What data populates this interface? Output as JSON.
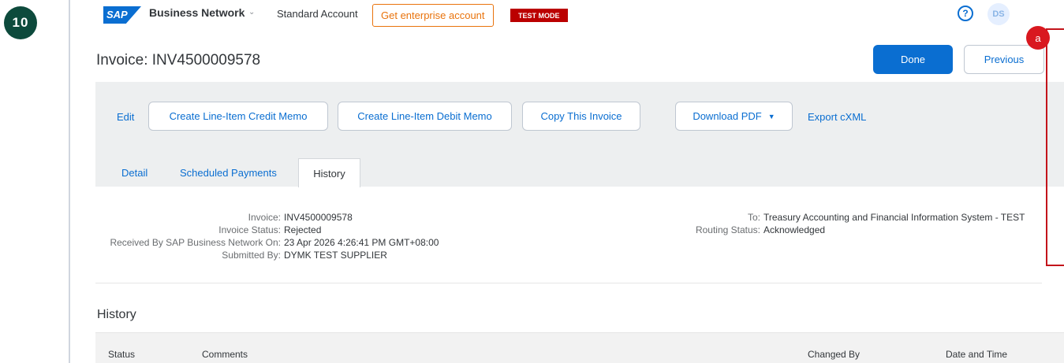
{
  "step": "10",
  "topbar": {
    "brand": "SAP",
    "product": "Business Network",
    "caret": "⌄",
    "account": "Standard Account",
    "enterprise_button": "Get enterprise account",
    "mode_badge": "TEST MODE",
    "help": "?",
    "avatar": "DS"
  },
  "header": {
    "title": "Invoice: INV4500009578",
    "done": "Done",
    "previous": "Previous"
  },
  "actions": {
    "edit": "Edit",
    "credit_memo": "Create Line-Item Credit Memo",
    "debit_memo": "Create Line-Item Debit Memo",
    "copy": "Copy This Invoice",
    "download": "Download PDF",
    "download_caret": "▼",
    "export": "Export cXML"
  },
  "tabs": {
    "detail": "Detail",
    "scheduled": "Scheduled Payments",
    "history": "History"
  },
  "summary": {
    "left": [
      {
        "label": "Invoice:",
        "value": "INV4500009578"
      },
      {
        "label": "Invoice Status:",
        "value": "Rejected"
      },
      {
        "label": "Received By SAP Business Network On:",
        "value": "23 Apr 2026 4:26:41 PM GMT+08:00"
      },
      {
        "label": "Submitted By:",
        "value": "DYMK TEST SUPPLIER"
      }
    ],
    "right": [
      {
        "label": "To:",
        "value": "Treasury Accounting and Financial Information System - TEST"
      },
      {
        "label": "Routing Status:",
        "value": "Acknowledged"
      }
    ]
  },
  "history": {
    "title": "History",
    "columns": [
      "Status",
      "Comments",
      "Changed By",
      "Date and Time"
    ]
  },
  "callout": "a"
}
